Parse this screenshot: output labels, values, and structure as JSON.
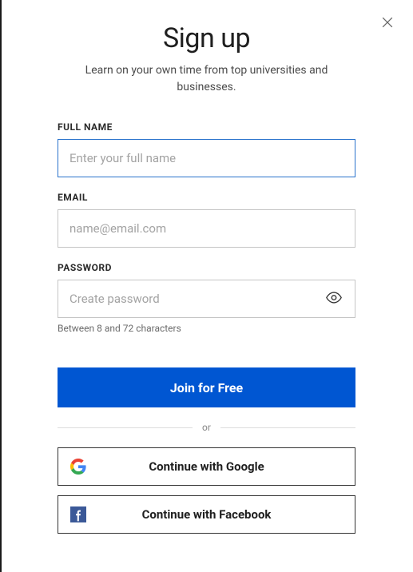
{
  "header": {
    "title": "Sign up",
    "subtitle": "Learn on your own time from top universities and businesses."
  },
  "form": {
    "fullname": {
      "label": "FULL NAME",
      "placeholder": "Enter your full name",
      "value": ""
    },
    "email": {
      "label": "EMAIL",
      "placeholder": "name@email.com",
      "value": ""
    },
    "password": {
      "label": "PASSWORD",
      "placeholder": "Create password",
      "value": "",
      "hint": "Between 8 and 72 characters"
    },
    "submit_label": "Join for Free"
  },
  "divider_text": "or",
  "social": {
    "google": "Continue with Google",
    "facebook": "Continue with Facebook"
  },
  "colors": {
    "primary": "#0056d2",
    "focus": "#2a73cc",
    "facebook": "#3b5998"
  }
}
